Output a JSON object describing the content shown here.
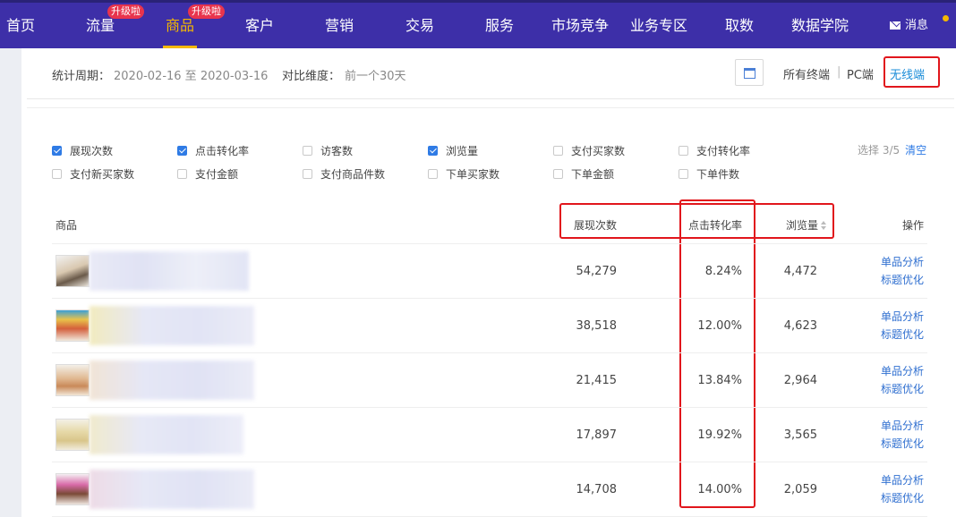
{
  "nav": {
    "items": [
      {
        "label": "首页",
        "badge": ""
      },
      {
        "label": "流量",
        "badge": "升级啦"
      },
      {
        "label": "商品",
        "badge": "升级啦",
        "active": true
      },
      {
        "label": "客户",
        "badge": ""
      },
      {
        "label": "营销",
        "badge": ""
      },
      {
        "label": "交易",
        "badge": ""
      },
      {
        "label": "服务",
        "badge": ""
      },
      {
        "label": "市场竞争",
        "badge": ""
      },
      {
        "label": "业务专区",
        "badge": ""
      },
      {
        "label": "取数",
        "badge": ""
      },
      {
        "label": "数据学院",
        "badge": ""
      }
    ],
    "message": "消息"
  },
  "filter": {
    "period_label": "统计周期：",
    "period_value": "2020-02-16 至 2020-03-16",
    "compare_label": "对比维度：",
    "compare_value": "前一个30天",
    "terminals": [
      "所有终端",
      "PC端",
      "无线端"
    ],
    "separator": "|",
    "selected_terminal": "无线端"
  },
  "metrics": {
    "options": [
      {
        "label": "展现次数",
        "checked": true
      },
      {
        "label": "点击转化率",
        "checked": true
      },
      {
        "label": "访客数",
        "checked": false
      },
      {
        "label": "浏览量",
        "checked": true
      },
      {
        "label": "支付买家数",
        "checked": false
      },
      {
        "label": "支付转化率",
        "checked": false
      },
      {
        "label": "支付新买家数",
        "checked": false
      },
      {
        "label": "支付金额",
        "checked": false
      },
      {
        "label": "支付商品件数",
        "checked": false
      },
      {
        "label": "下单买家数",
        "checked": false
      },
      {
        "label": "下单金额",
        "checked": false
      },
      {
        "label": "下单件数",
        "checked": false
      }
    ],
    "selected_count": "选择 3/5",
    "clear": "清空"
  },
  "table": {
    "headers": {
      "product": "商品",
      "impressions": "展现次数",
      "ctr": "点击转化率",
      "pageviews": "浏览量",
      "action": "操作"
    },
    "rows": [
      {
        "impressions": "54,279",
        "ctr": "8.24%",
        "pageviews": "4,472"
      },
      {
        "impressions": "38,518",
        "ctr": "12.00%",
        "pageviews": "4,623"
      },
      {
        "impressions": "21,415",
        "ctr": "13.84%",
        "pageviews": "2,964"
      },
      {
        "impressions": "17,897",
        "ctr": "19.92%",
        "pageviews": "3,565"
      },
      {
        "impressions": "14,708",
        "ctr": "14.00%",
        "pageviews": "2,059"
      }
    ],
    "actions": {
      "analyze": "单品分析",
      "optimize": "标题优化"
    }
  },
  "colors": {
    "nav_bg": "#3d2fa8",
    "active": "#f5b800",
    "badge": "#e8344d",
    "link": "#2f6fd0",
    "highlight": "#e1161c"
  }
}
